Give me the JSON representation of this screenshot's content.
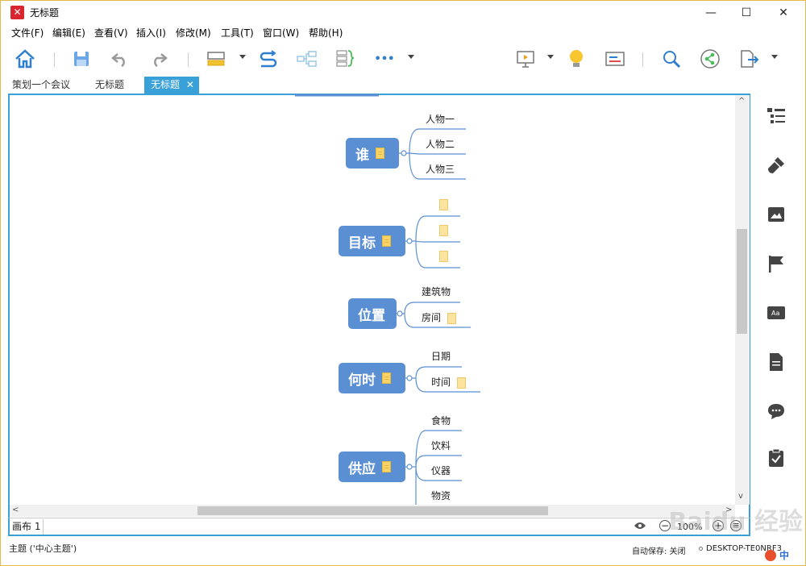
{
  "window": {
    "title": "无标题",
    "logo_glyph": "✕",
    "minimize_glyph": "—",
    "maximize_glyph": "☐",
    "close_glyph": "✕"
  },
  "menu": [
    "文件(F)",
    "编辑(E)",
    "查看(V)",
    "插入(I)",
    "修改(M)",
    "工具(T)",
    "窗口(W)",
    "帮助(H)"
  ],
  "toolbar": {
    "icons": [
      "home-icon",
      "save-icon",
      "undo-icon",
      "redo-icon",
      "topic-style-icon",
      "relationship-icon",
      "boundary-icon",
      "summary-icon",
      "more-icon",
      "presentation-icon",
      "idea-icon",
      "gantt-icon",
      "search-icon",
      "share-icon",
      "export-icon"
    ],
    "more_glyph": "•••"
  },
  "tabs": [
    {
      "label": "策划一个会议",
      "active": false
    },
    {
      "label": "无标题",
      "active": false
    },
    {
      "label": "无标题",
      "active": true
    }
  ],
  "tab_close_glyph": "✕",
  "mindmap": {
    "topics": [
      {
        "label": "谁",
        "subtopics": [
          {
            "label": "人物一",
            "note": false
          },
          {
            "label": "人物二",
            "note": false
          },
          {
            "label": "人物三",
            "note": false
          }
        ]
      },
      {
        "label": "目标",
        "subtopics": [
          {
            "label": "",
            "note": true
          },
          {
            "label": "",
            "note": true
          },
          {
            "label": "",
            "note": true
          }
        ]
      },
      {
        "label": "位置",
        "subtopics": [
          {
            "label": "建筑物",
            "note": false
          },
          {
            "label": "房间",
            "note": true
          }
        ]
      },
      {
        "label": "何时",
        "subtopics": [
          {
            "label": "日期",
            "note": false
          },
          {
            "label": "时间",
            "note": true
          }
        ]
      },
      {
        "label": "供应",
        "subtopics": [
          {
            "label": "食物",
            "note": false
          },
          {
            "label": "饮料",
            "note": false
          },
          {
            "label": "仪器",
            "note": false
          },
          {
            "label": "物资",
            "note": false
          }
        ]
      }
    ],
    "topic_color": "#5b8fd4",
    "line_color": "#5b8fd4"
  },
  "sheet": {
    "label": "画布 1"
  },
  "zoom": {
    "value": "100%",
    "minus": "−",
    "plus": "+",
    "menu": "≡"
  },
  "status": {
    "selection": "主题 ('中心主题')",
    "autosave": "自动保存: 关闭",
    "computer": "DESKTOP-TE0NRF3"
  },
  "side_icons": [
    "outline-icon",
    "format-brush-icon",
    "image-icon",
    "flag-marker-icon",
    "text-style-icon",
    "notes-icon",
    "comment-icon",
    "task-icon"
  ],
  "scroll": {
    "left": "<",
    "right": ">",
    "up": "^",
    "down": "v"
  },
  "watermark": "Baidu 经验",
  "ime": {
    "label": "中"
  },
  "colors": {
    "accent": "#3aa0d8",
    "tab_active_bg": "#3aa0d8",
    "frame": "#e8b84a"
  }
}
